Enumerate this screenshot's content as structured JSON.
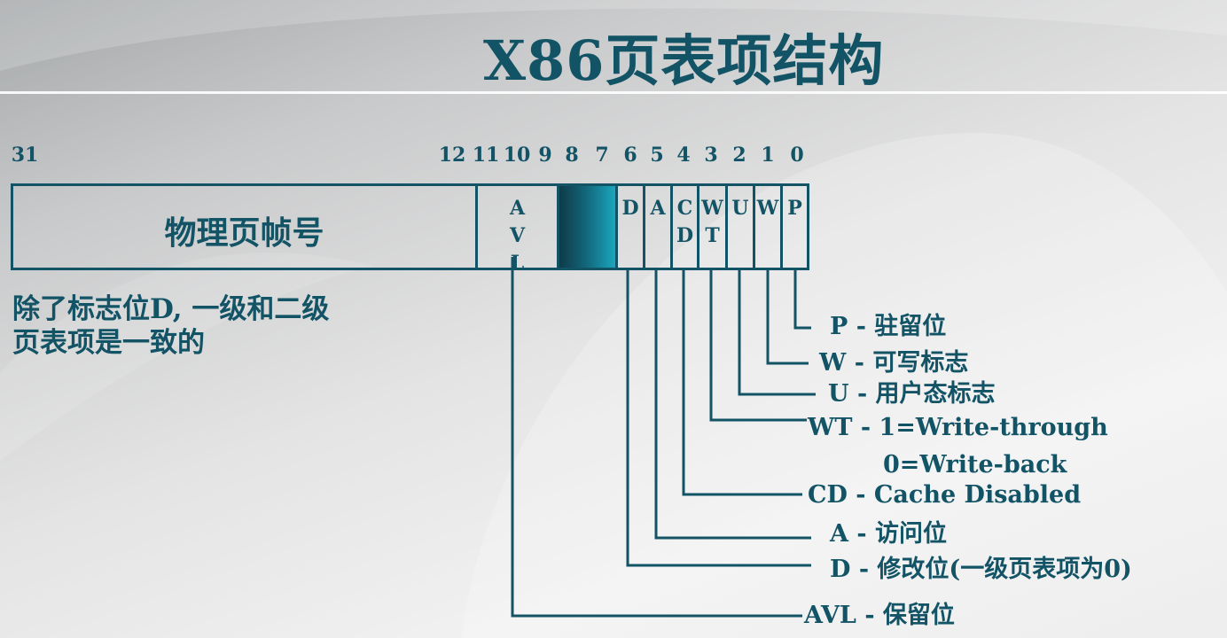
{
  "title": "X86页表项结构",
  "bit_numbers": [
    "31",
    "12",
    "11",
    "10",
    "9",
    "8",
    "7",
    "6",
    "5",
    "4",
    "3",
    "2",
    "1",
    "0"
  ],
  "register": {
    "frame_label": "物理页帧号",
    "avl": [
      "A",
      "V",
      "L"
    ],
    "flags": {
      "d": [
        "D"
      ],
      "a": [
        "A"
      ],
      "cd": [
        "C",
        "D"
      ],
      "wt": [
        "W",
        "T"
      ],
      "u": [
        "U"
      ],
      "w": [
        "W"
      ],
      "p": [
        "P"
      ]
    }
  },
  "note": [
    "除了标志位D, 一级和二级",
    "页表项是一致的"
  ],
  "legend": [
    "P - 驻留位",
    "W - 可写标志",
    "U - 用户态标志",
    "WT - 1=Write-through",
    "0=Write-back",
    "CD - Cache Disabled",
    "A - 访问位",
    "D - 修改位(一级页表项为0)",
    "AVL - 保留位"
  ],
  "colors": {
    "primary": "#135366",
    "reserved_fill": "#126478"
  }
}
